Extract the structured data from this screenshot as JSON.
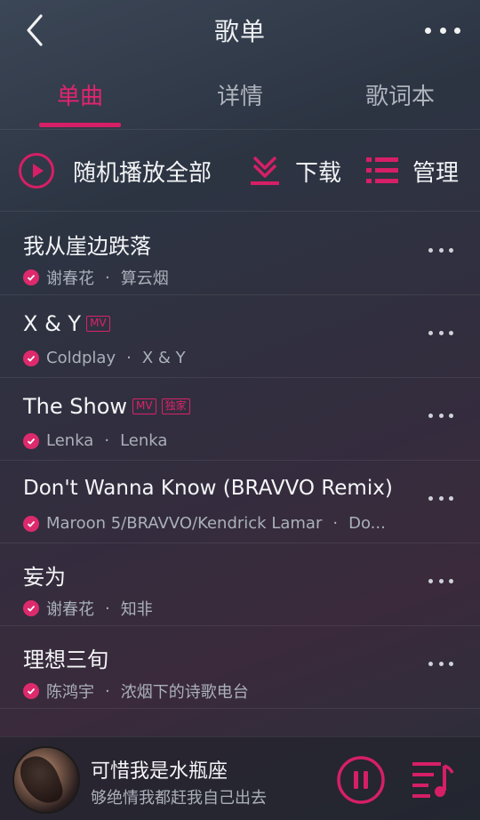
{
  "header": {
    "title": "歌单"
  },
  "tabs": [
    {
      "label": "单曲",
      "active": true
    },
    {
      "label": "详情",
      "active": false
    },
    {
      "label": "歌词本",
      "active": false
    }
  ],
  "actions": {
    "play_all_label": "随机播放全部",
    "download_label": "下载",
    "manage_label": "管理"
  },
  "songs": [
    {
      "title": "我从崖边跌落",
      "artist": "谢春花",
      "album": "算云烟",
      "tags": []
    },
    {
      "title": "X & Y",
      "artist": "Coldplay",
      "album": "X & Y",
      "tags": [
        "MV"
      ]
    },
    {
      "title": "The Show",
      "artist": "Lenka",
      "album": "Lenka",
      "tags": [
        "MV",
        "独家"
      ]
    },
    {
      "title": "Don't Wanna Know (BRAVVO Remix)",
      "artist": "Maroon 5/BRAVVO/Kendrick Lamar",
      "album": "Do...",
      "tags": []
    },
    {
      "title": "妄为",
      "artist": "谢春花",
      "album": "知非",
      "tags": []
    },
    {
      "title": "理想三旬",
      "artist": "陈鸿宇",
      "album": "浓烟下的诗歌电台",
      "tags": []
    }
  ],
  "player": {
    "title": "可惜我是水瓶座",
    "subtitle": "够绝情我都赶我自己出去"
  },
  "colors": {
    "accent": "#e0246f",
    "text": "#f4f5f7",
    "muted": "#aab0b9"
  },
  "icons": [
    "back-icon",
    "more-icon",
    "play-circle-icon",
    "download-icon",
    "manage-list-icon",
    "downloaded-check-icon",
    "pause-icon",
    "playlist-queue-icon"
  ]
}
